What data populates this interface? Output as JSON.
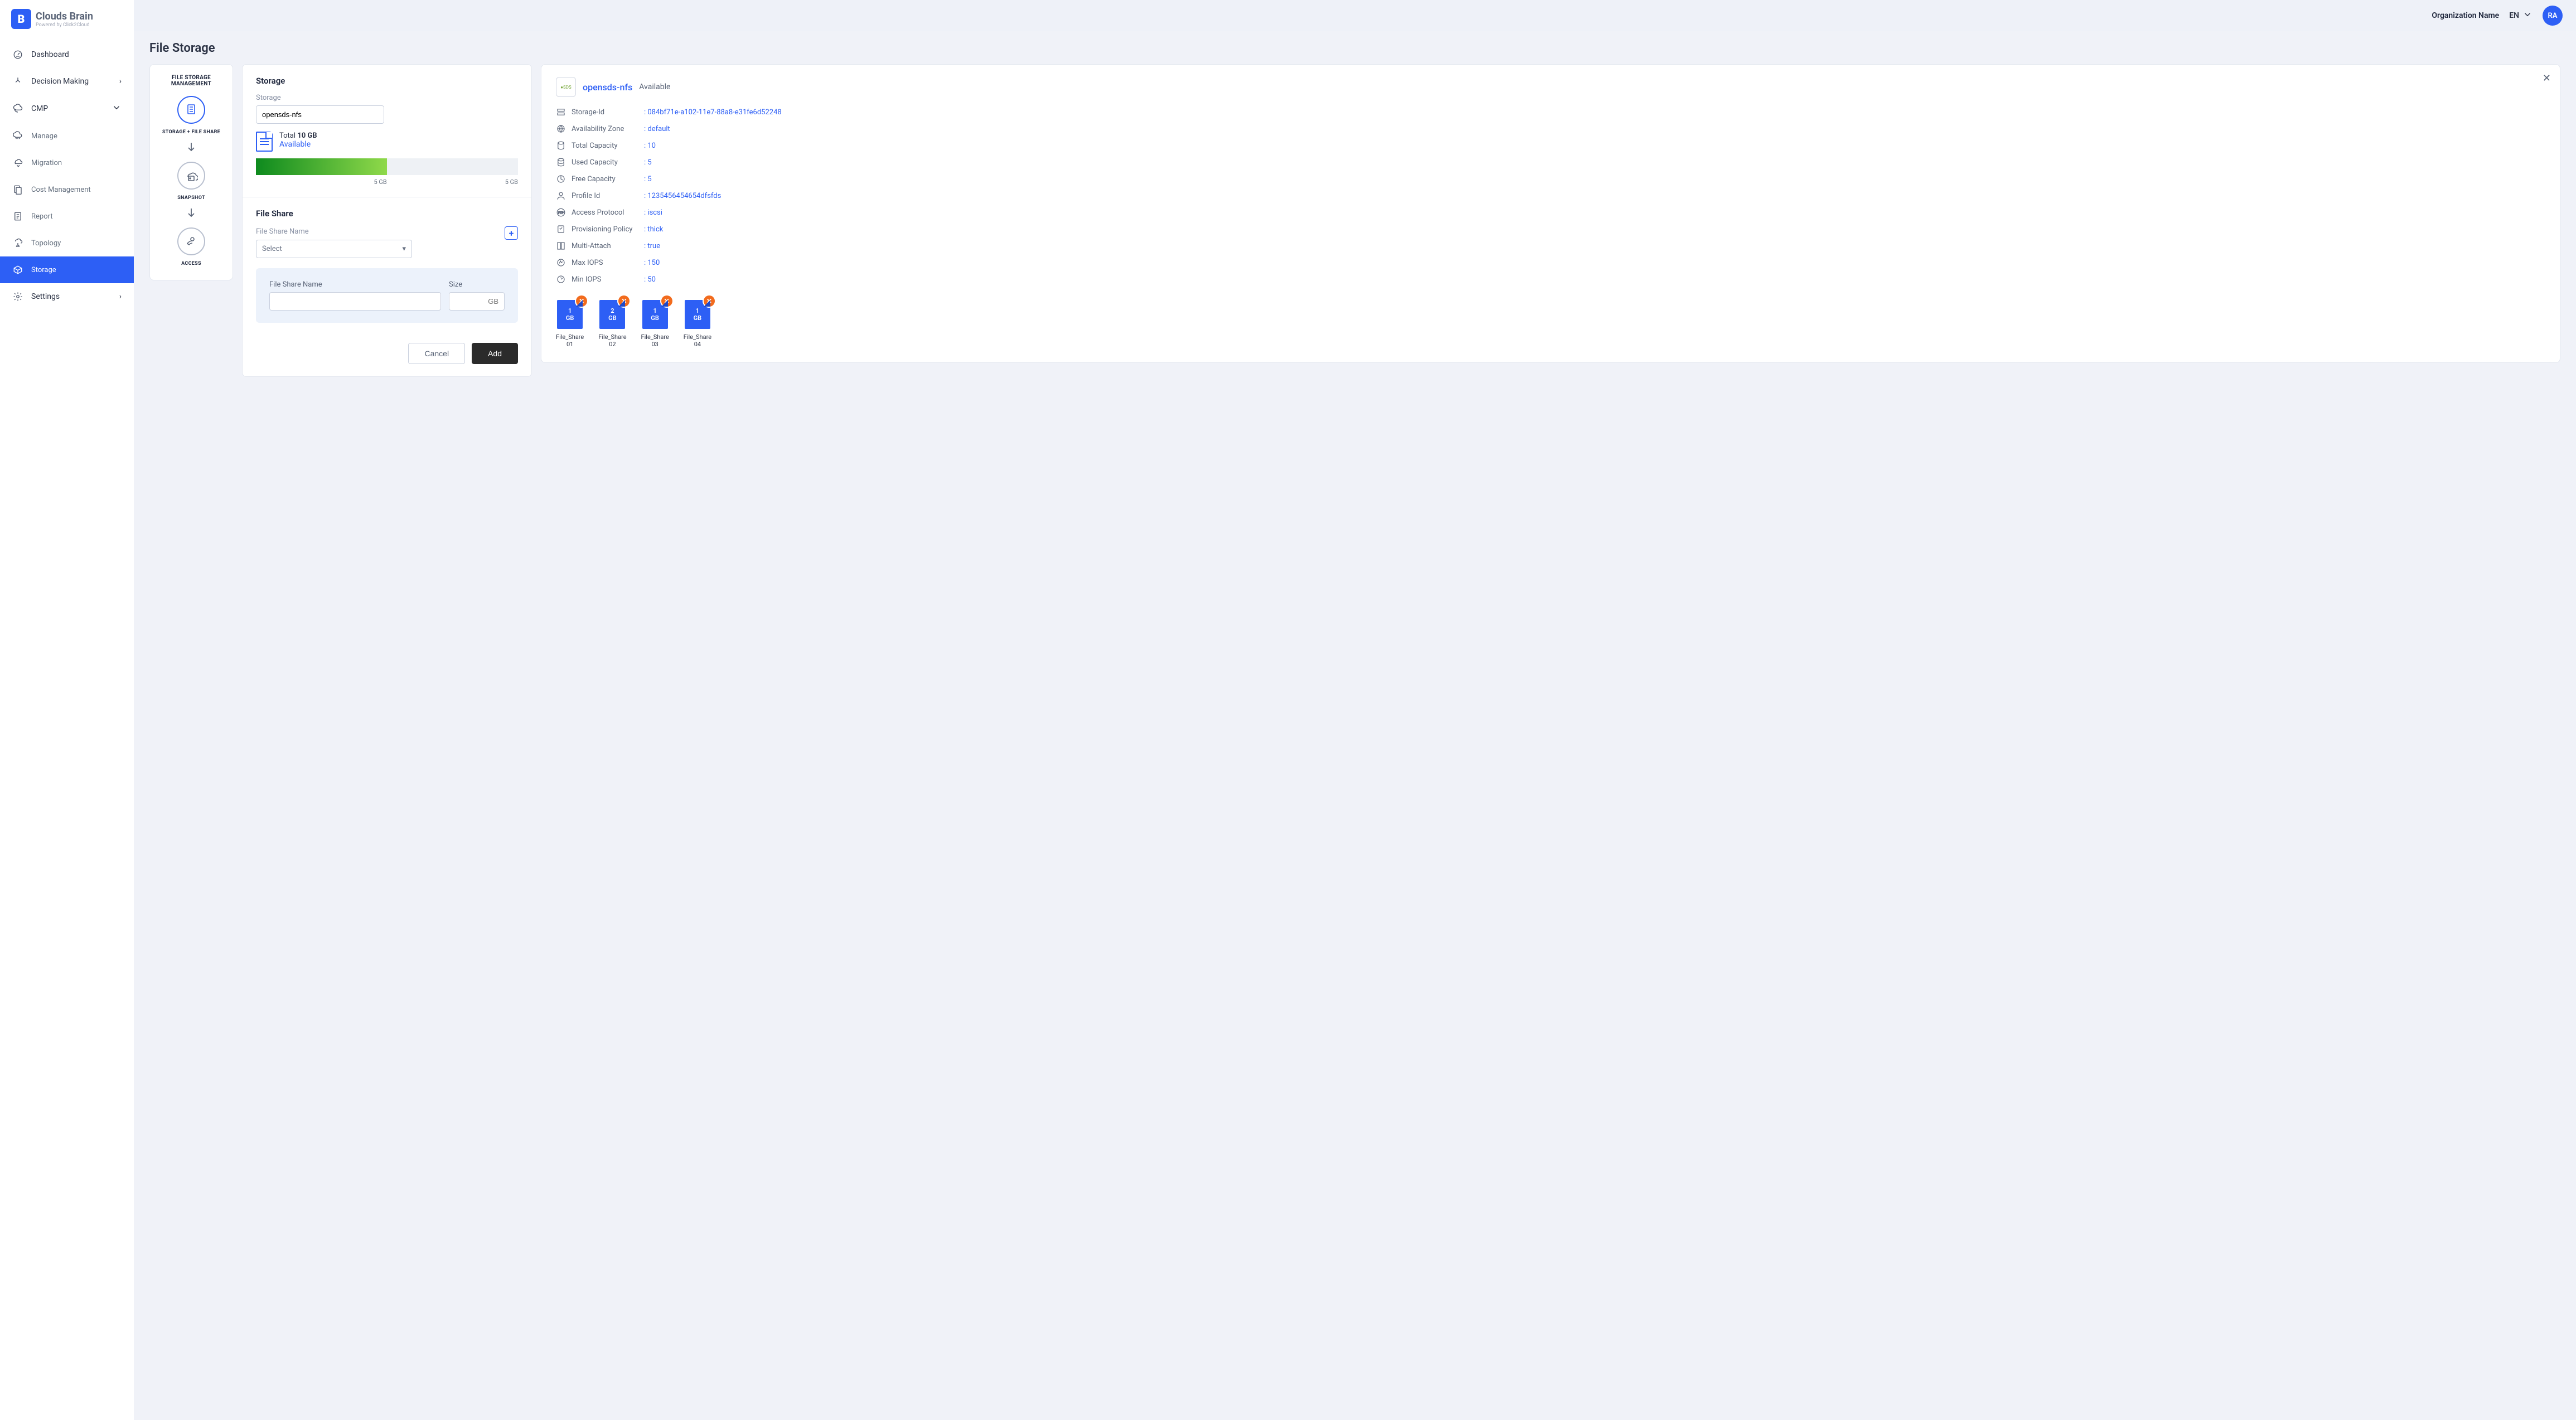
{
  "brand": {
    "name": "Clouds Brain",
    "tagline": "Powered by Click2Cloud"
  },
  "topbar": {
    "org": "Organization Name",
    "lang": "EN",
    "avatar": "RA"
  },
  "nav": {
    "dashboard": "Dashboard",
    "decision": "Decision Making",
    "cmp": "CMP",
    "manage": "Manage",
    "migration": "Migration",
    "cost": "Cost Management",
    "report": "Report",
    "topology": "Topology",
    "storage": "Storage",
    "settings": "Settings"
  },
  "page": {
    "title": "File Storage"
  },
  "steps": {
    "heading": "FILE STORAGE MANAGEMENT",
    "one": "STORAGE + FILE SHARE",
    "two": "SNAPSHOT",
    "three": "ACCESS"
  },
  "storage": {
    "section_title": "Storage",
    "field_label": "Storage",
    "value": "opensds-nfs",
    "total_prefix": "Total ",
    "total_value": "10 GB",
    "status": "Available",
    "used_label": "5 GB",
    "free_label": "5 GB"
  },
  "fileshare": {
    "section_title": "File Share",
    "name_label": "File Share Name",
    "select_placeholder": "Select",
    "form_name_label": "File Share Name",
    "form_size_label": "Size",
    "size_unit": "GB",
    "cancel": "Cancel",
    "add": "Add"
  },
  "details": {
    "name": "opensds-nfs",
    "status": "Available",
    "labels": {
      "storage_id": "Storage-Id",
      "az": "Availability Zone",
      "total": "Total Capacity",
      "used": "Used Capacity",
      "free": "Free Capacity",
      "profile": "Profile Id",
      "protocol": "Access Protocol",
      "policy": "Provisioning Policy",
      "multi": "Multi-Attach",
      "max_iops": "Max IOPS",
      "min_iops": "Min IOPS"
    },
    "values": {
      "storage_id": ": 084bf71e-a102-11e7-88a8-e31fe6d52248",
      "az": ": default",
      "total": ": 10",
      "used": ": 5",
      "free": ": 5",
      "profile": ": 1235456454654dfsfds",
      "protocol": ": iscsi",
      "policy": ": thick",
      "multi": ": true",
      "max_iops": ": 150",
      "min_iops": ": 50"
    }
  },
  "shares": [
    {
      "size_n": "1",
      "size_u": "GB",
      "name": "File_Share\n01"
    },
    {
      "size_n": "2",
      "size_u": "GB",
      "name": "File_Share\n02"
    },
    {
      "size_n": "1",
      "size_u": "GB",
      "name": "File_Share\n03"
    },
    {
      "size_n": "1",
      "size_u": "GB",
      "name": "File_Share\n04"
    }
  ]
}
